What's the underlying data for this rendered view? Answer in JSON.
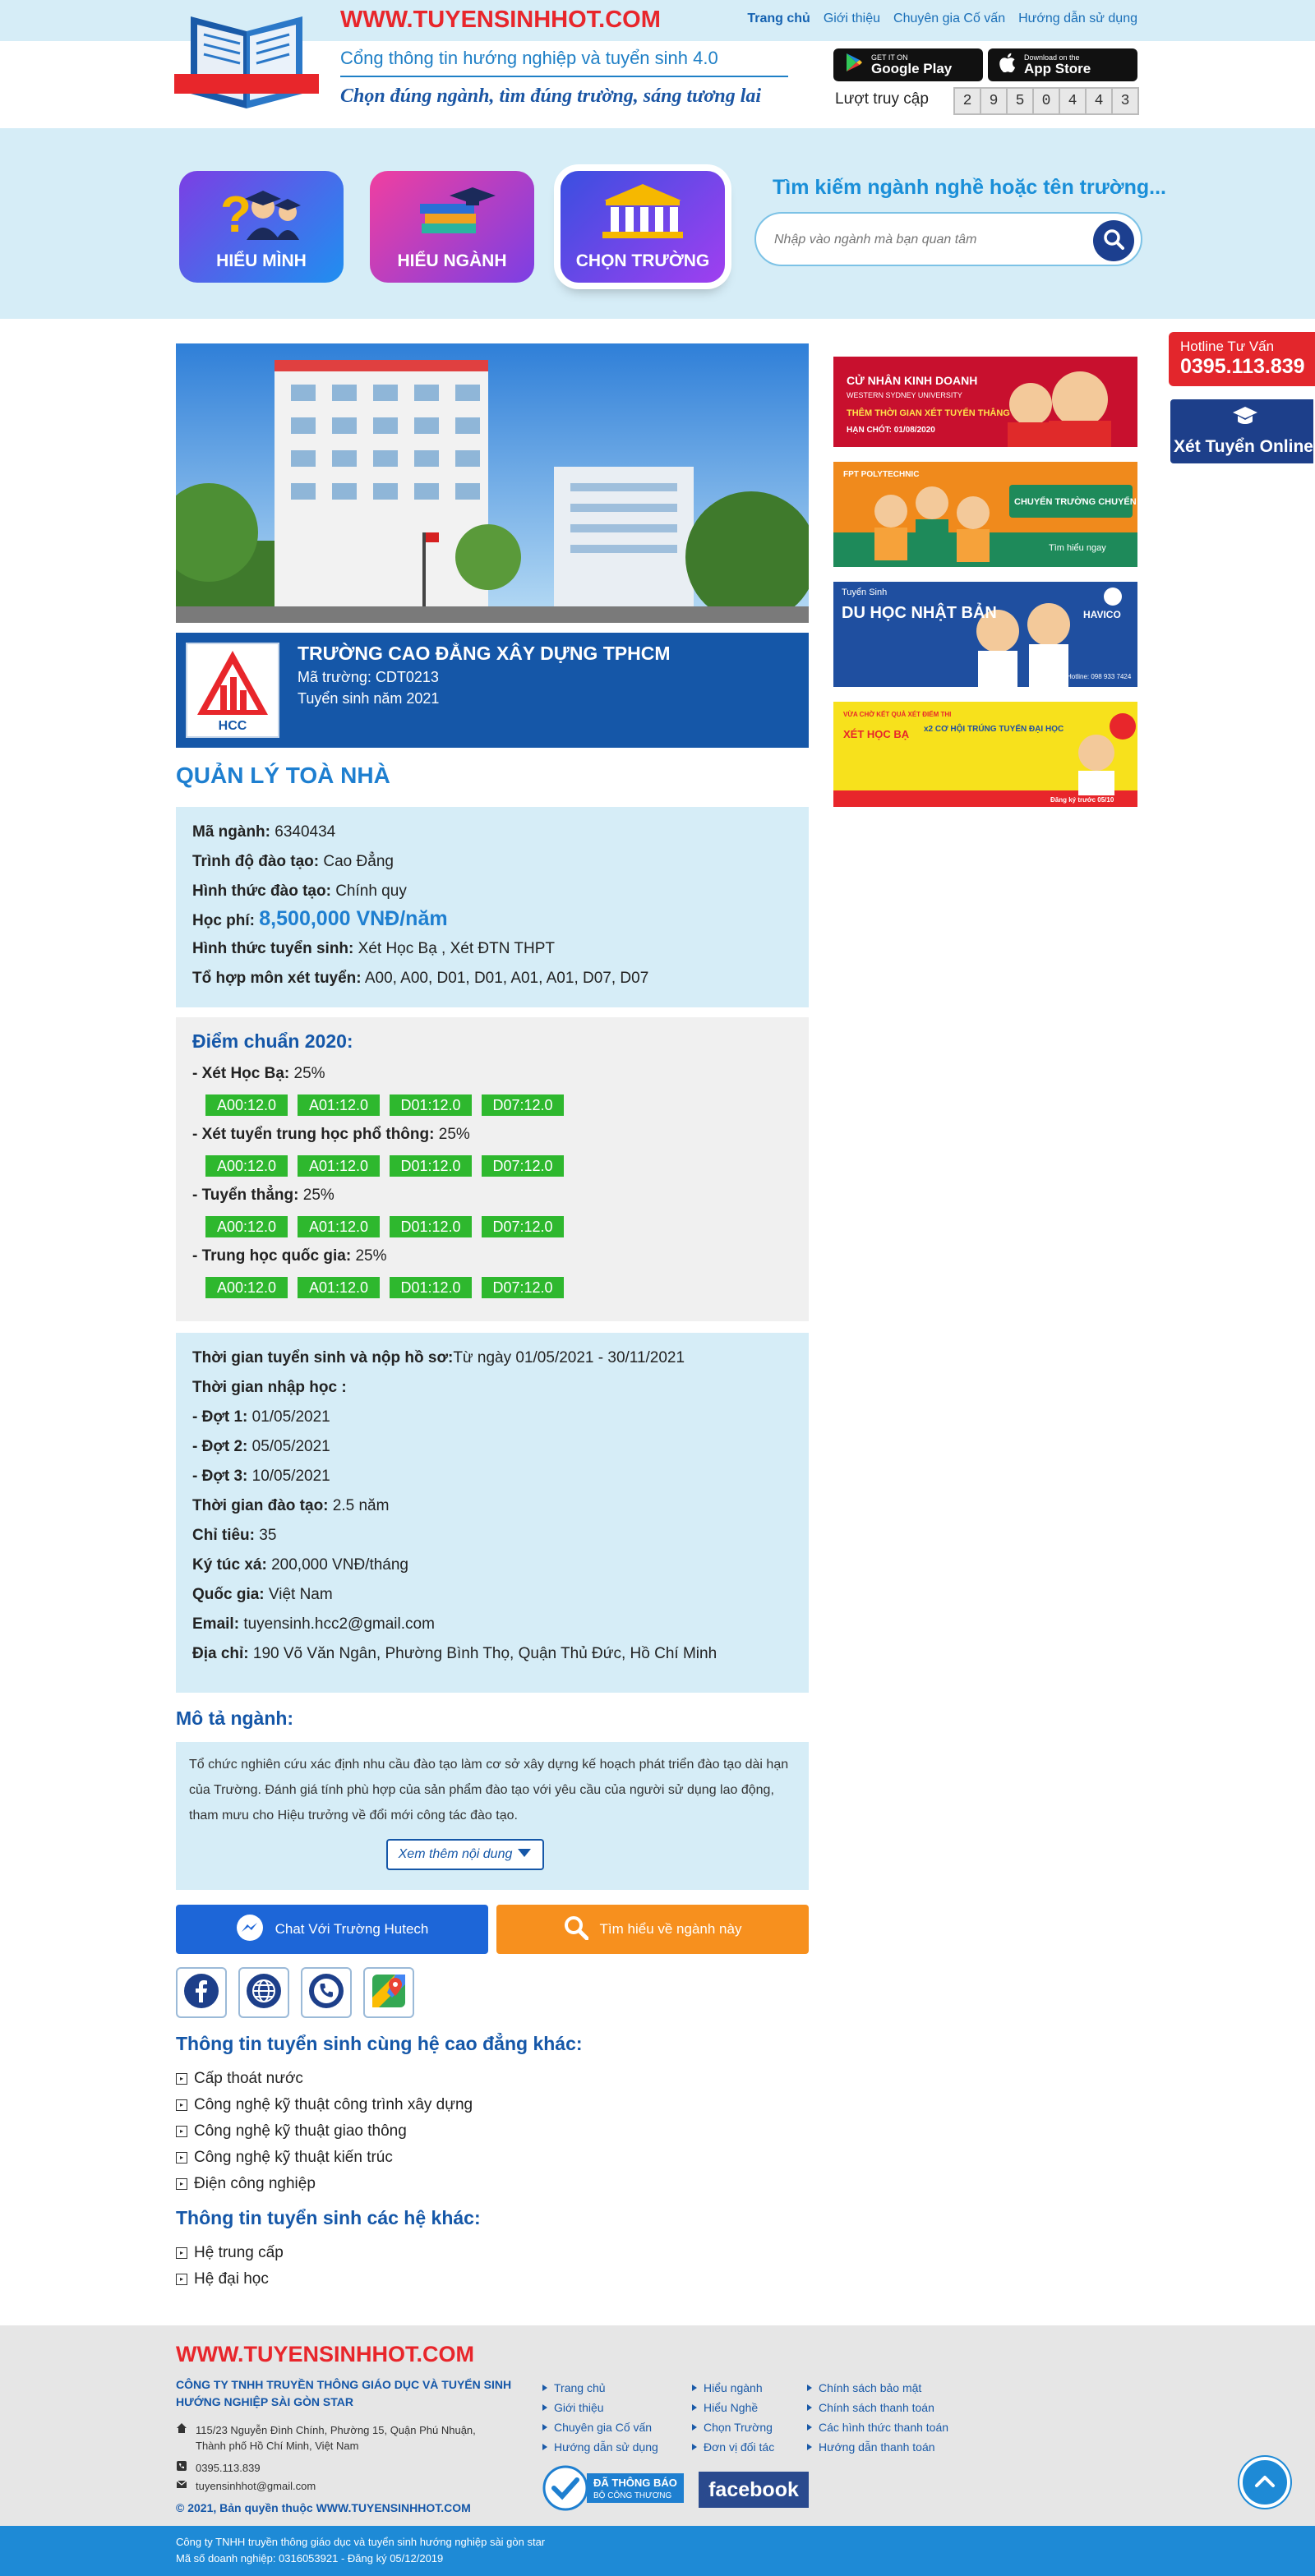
{
  "header": {
    "site_url": "WWW.TUYENSINHHOT.COM",
    "tagline1": "Cổng thông tin hướng nghiệp và tuyển sinh 4.0",
    "tagline2": "Chọn đúng ngành, tìm đúng trường, sáng tương lai",
    "nav": [
      "Trang chủ",
      "Giới thiệu",
      "Chuyên gia Cố vấn",
      "Hướng dẫn sử dụng"
    ],
    "store_google": {
      "small": "GET IT ON",
      "big": "Google Play"
    },
    "store_apple": {
      "small": "Download on the",
      "big": "App Store"
    },
    "visits_label": "Lượt truy cập",
    "visits_digits": [
      "2",
      "9",
      "5",
      "0",
      "4",
      "4",
      "3"
    ]
  },
  "tiles": [
    {
      "label": "HIỂU MÌNH"
    },
    {
      "label": "HIỂU NGÀNH"
    },
    {
      "label": "CHỌN TRƯỜNG"
    }
  ],
  "search": {
    "title": "Tìm kiếm ngành nghề hoặc tên trường...",
    "placeholder": "Nhập vào ngành mà bạn quan tâm"
  },
  "school": {
    "name": "TRƯỜNG CAO ĐẲNG XÂY DỰNG TPHCM",
    "code": "Mã trường: CDT0213",
    "year": "Tuyển sinh năm 2021",
    "logo_text": "HCC"
  },
  "major": {
    "title": "QUẢN LÝ TOÀ NHÀ",
    "info": [
      {
        "label": "Mã ngành:",
        "value": "6340434"
      },
      {
        "label": "Trình độ đào tạo:",
        "value": "Cao Đẳng"
      },
      {
        "label": "Hình thức đào tạo:",
        "value": "Chính quy"
      },
      {
        "label": "Học phí:",
        "value": "8,500,000 VNĐ/năm"
      },
      {
        "label": "Hình thức tuyển sinh:",
        "value": "Xét Học Bạ , Xét ĐTN THPT"
      },
      {
        "label": "Tổ hợp môn xét tuyển:",
        "value": "A00, A00, D01, D01, A01, A01, D07, D07"
      }
    ]
  },
  "scores": {
    "title": "Điểm chuẩn 2020:",
    "groups": [
      {
        "label": "- Xét Học Bạ:",
        "pct": "25%",
        "chips": [
          "A00:12.0",
          "A01:12.0",
          "D01:12.0",
          "D07:12.0"
        ]
      },
      {
        "label": "- Xét tuyển trung học phổ thông:",
        "pct": "25%",
        "chips": [
          "A00:12.0",
          "A01:12.0",
          "D01:12.0",
          "D07:12.0"
        ]
      },
      {
        "label": "- Tuyển thẳng:",
        "pct": "25%",
        "chips": [
          "A00:12.0",
          "A01:12.0",
          "D01:12.0",
          "D07:12.0"
        ]
      },
      {
        "label": "- Trung học quốc gia:",
        "pct": "25%",
        "chips": [
          "A00:12.0",
          "A01:12.0",
          "D01:12.0",
          "D07:12.0"
        ]
      }
    ]
  },
  "admission": [
    {
      "label": "Thời gian tuyển sinh và nộp hồ sơ:",
      "value": "Từ ngày 01/05/2021 - 30/11/2021"
    },
    {
      "label": "Thời gian nhập học :",
      "value": ""
    },
    {
      "label": " - Đợt 1:",
      "value": "01/05/2021"
    },
    {
      "label": " - Đợt 2:",
      "value": "05/05/2021"
    },
    {
      "label": " - Đợt 3:",
      "value": "10/05/2021"
    },
    {
      "label": "Thời gian đào tạo:",
      "value": "2.5 năm"
    },
    {
      "label": "Chỉ tiêu:",
      "value": "35"
    },
    {
      "label": "Ký túc xá:",
      "value": "200,000 VNĐ/tháng"
    },
    {
      "label": "Quốc gia:",
      "value": "Việt Nam"
    },
    {
      "label": "Email:",
      "value": "tuyensinh.hcc2@gmail.com"
    },
    {
      "label": "Địa chỉ:",
      "value": "190 Võ Văn Ngân, Phường Bình Thọ, Quận Thủ Đức, Hồ Chí Minh"
    }
  ],
  "description": {
    "title": "Mô tả ngành:",
    "text": "Tổ chức nghiên cứu xác định nhu cầu đào tạo làm cơ sở xây dựng kế hoạch phát triển đào tạo dài hạn của Trường. Đánh giá tính phù hợp của sản phẩm đào tạo với yêu cầu của người sử dụng lao động, tham mưu cho Hiệu trưởng về đổi mới công tác đào tạo.",
    "more": "Xem thêm nội dung"
  },
  "actions": {
    "chat": "Chat Với Trường Hutech",
    "explore": "Tìm hiểu về ngành này"
  },
  "related": {
    "same_level_title": "Thông tin tuyển sinh cùng hệ cao đẳng khác:",
    "same_level": [
      "Cấp thoát nước",
      "Công nghệ kỹ thuật công trình xây dựng",
      "Công nghệ kỹ thuật giao thông",
      "Công nghệ kỹ thuật kiến trúc",
      "Điện công nghiệp"
    ],
    "other_level_title": "Thông tin tuyển sinh các hệ khác:",
    "other_level": [
      "Hệ trung cấp",
      "Hệ đại học"
    ]
  },
  "ads": [
    {
      "headline": "CỬ NHÂN KINH DOANH",
      "sub": "WESTERN SYDNEY UNIVERSITY",
      "extra": "THÊM THỜI GIAN XÉT TUYỂN THẲNG",
      "deadline": "HẠN CHÓT: 01/08/2020",
      "color": "#c8102e"
    },
    {
      "headline": "CHUYỂN TRƯỜNG CHUYỂN HỌC PHÍ",
      "sub": "FPT POLYTECHNIC",
      "extra": "Tìm hiểu ngay",
      "color": "#f08a1c"
    },
    {
      "headline": "DU HỌC NHẬT BẢN",
      "sub": "Tuyển Sinh",
      "extra": "HAVICO",
      "deadline": "Hotline: 098 933 7424",
      "color": "#1f4fa0"
    },
    {
      "headline": "XÉT HỌC BẠ",
      "sub": "VỪA CHỜ KẾT QUẢ XÉT ĐIỂM THI",
      "extra": "x2 CƠ HỘI TRÚNG TUYỂN ĐẠI HỌC",
      "deadline": "Đăng ký trước 05/10",
      "color": "#f7e11c"
    }
  ],
  "float": {
    "hotline_label": "Hotline Tư Vấn",
    "hotline_number": "0395.113.839",
    "xettuyen": "Xét Tuyển Online"
  },
  "footer": {
    "url": "WWW.TUYENSINHHOT.COM",
    "company": "CÔNG TY TNHH TRUYỀN THÔNG GIÁO DỤC VÀ TUYỂN SINH HƯỚNG NGHIỆP SÀI GÒN STAR",
    "address": "115/23 Nguyễn Đình Chính, Phường 15, Quận Phú Nhuận, Thành phố Hồ Chí Minh, Việt Nam",
    "phone": "0395.113.839",
    "email": "tuyensinhhot@gmail.com",
    "copyright": "© 2021, Bản quyền thuộc WWW.TUYENSINHHOT.COM",
    "col1": [
      "Trang chủ",
      "Giới thiệu",
      "Chuyên gia Cố vấn",
      "Hướng dẫn sử dụng"
    ],
    "col2": [
      "Hiểu ngành",
      "Hiểu Nghề",
      "Chọn Trường",
      "Đơn vị đối tác"
    ],
    "col3": [
      "Chính sách bảo mật",
      "Chính sách thanh toán",
      "Các hình thức thanh toán",
      "Hướng dẫn thanh toán"
    ],
    "bct_line1": "ĐÃ THÔNG BÁO",
    "bct_line2": "BỘ CÔNG THƯƠNG",
    "facebook": "facebook"
  },
  "bottom": {
    "line1": "Công ty TNHH truyền thông giáo dục và tuyển sinh hướng nghiệp sài gòn star",
    "line2": "Mã số doanh nghiệp: 0316053921 - Đăng ký 05/12/2019"
  }
}
